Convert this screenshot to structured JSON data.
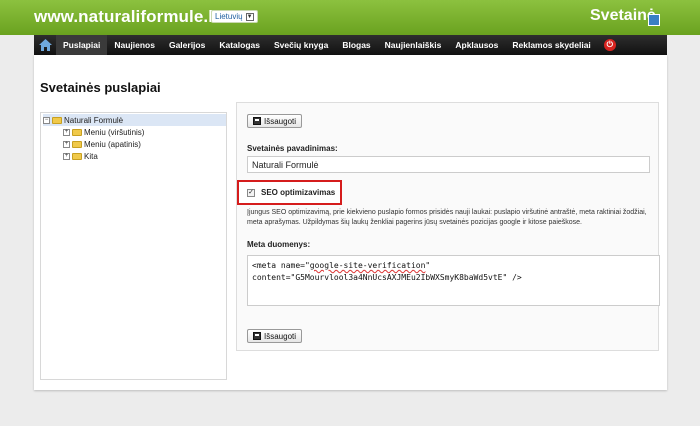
{
  "header": {
    "site_title": "www.naturaliformule.lt",
    "language": "Lietuvių",
    "brand": "Svetainė"
  },
  "nav": {
    "items": [
      "Puslapiai",
      "Naujienos",
      "Galerijos",
      "Katalogas",
      "Svečių knyga",
      "Blogas",
      "Naujienlaiškis",
      "Apklausos",
      "Reklamos skydeliai"
    ],
    "active_index": 0
  },
  "page": {
    "title": "Svetainės puslapiai"
  },
  "tree": {
    "root": "Naturali Formulė",
    "children": [
      "Meniu (viršutinis)",
      "Meniu (apatinis)",
      "Kita"
    ]
  },
  "form": {
    "save_label": "Išsaugoti",
    "site_name_label": "Svetainės pavadinimas:",
    "site_name_value": "Naturali Formulė",
    "seo_label": "SEO optimizavimas",
    "seo_checked": true,
    "help_text": "Įjungus SEO optimizavimą, prie kiekvieno puslapio formos prisidės nauji laukai: puslapio viršutinė antraštė, meta raktiniai žodžiai, meta aprašymas. Užpildymas šių laukų ženkliai pagerins jūsų svetainės pozicijas google ir kitose paieškose.",
    "meta_label": "Meta duomenys:",
    "meta_line1_a": "<meta name=\"",
    "meta_line1_b": "google-site-verification",
    "meta_line1_c": "\"",
    "meta_line2": "content=\"G5Mourvlool3a4NnUcsAXJMEu2IbWXSmyK8baWd5vtE\" />"
  },
  "colors": {
    "header_green": "#7ab22d",
    "nav_black": "#1c1c1c",
    "highlight_red": "#d51c1c"
  }
}
